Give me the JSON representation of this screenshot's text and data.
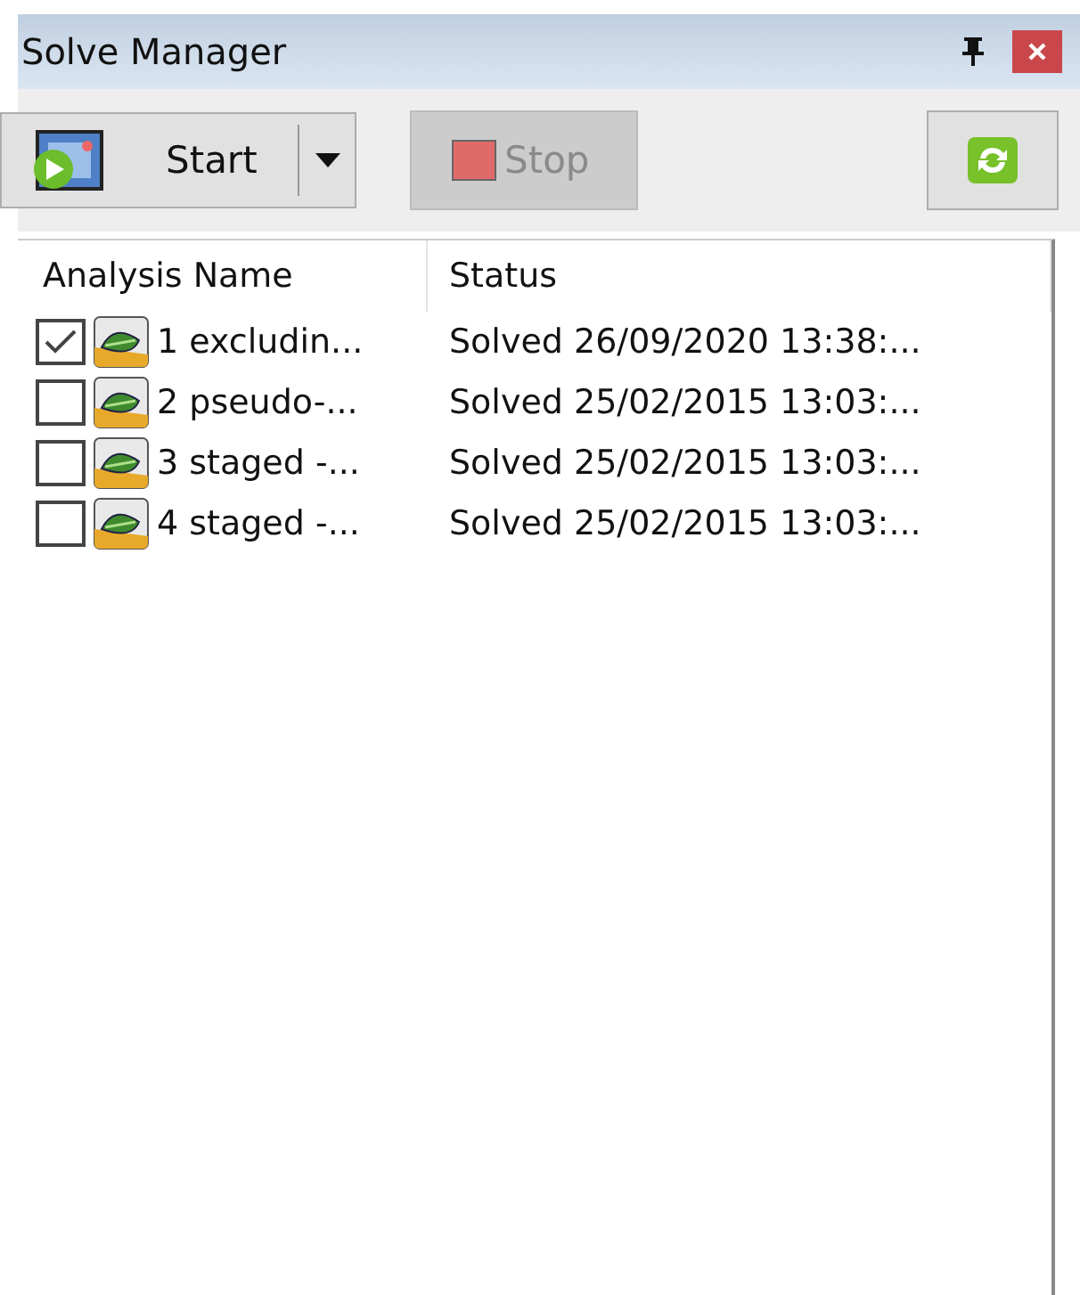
{
  "window": {
    "title": "Solve Manager"
  },
  "toolbar": {
    "start": {
      "label": "Start"
    },
    "stop": {
      "label": "Stop",
      "disabled": true
    }
  },
  "table": {
    "columns": [
      "Analysis Name",
      "Status"
    ],
    "rows": [
      {
        "checked": true,
        "name": "1 excludin...",
        "status": "Solved 26/09/2020 13:38:..."
      },
      {
        "checked": false,
        "name": "2 pseudo-...",
        "status": "Solved 25/02/2015 13:03:..."
      },
      {
        "checked": false,
        "name": "3 staged -...",
        "status": "Solved 25/02/2015 13:03:..."
      },
      {
        "checked": false,
        "name": "4 staged -...",
        "status": "Solved 25/02/2015 13:03:..."
      }
    ]
  }
}
